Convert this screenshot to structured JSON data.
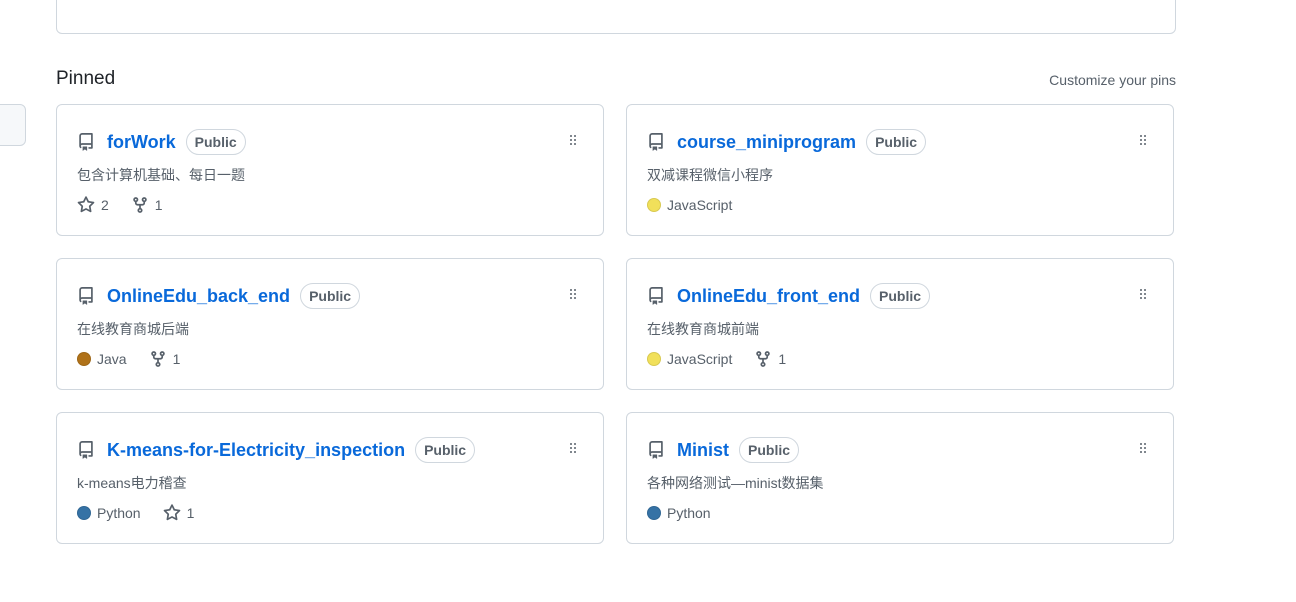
{
  "pinned": {
    "title": "Pinned",
    "customize_label": "Customize your pins"
  },
  "colors": {
    "link": "#0969da",
    "javascript": "#f1e05a",
    "java": "#b07219",
    "python": "#3572A5"
  },
  "repos": [
    {
      "name": "forWork",
      "visibility": "Public",
      "description": "包含计算机基础、每日一题",
      "language": "",
      "stars": "2",
      "forks": "1"
    },
    {
      "name": "course_miniprogram",
      "visibility": "Public",
      "description": "双减课程微信小程序",
      "language": "JavaScript",
      "stars": "",
      "forks": ""
    },
    {
      "name": "OnlineEdu_back_end",
      "visibility": "Public",
      "description": "在线教育商城后端",
      "language": "Java",
      "stars": "",
      "forks": "1"
    },
    {
      "name": "OnlineEdu_front_end",
      "visibility": "Public",
      "description": "在线教育商城前端",
      "language": "JavaScript",
      "stars": "",
      "forks": "1"
    },
    {
      "name": "K-means-for-Electricity_inspection",
      "visibility": "Public",
      "description": "k-means电力稽查",
      "language": "Python",
      "stars": "1",
      "forks": ""
    },
    {
      "name": "Minist",
      "visibility": "Public",
      "description": "各种网络测试—minist数据集",
      "language": "Python",
      "stars": "",
      "forks": ""
    }
  ]
}
